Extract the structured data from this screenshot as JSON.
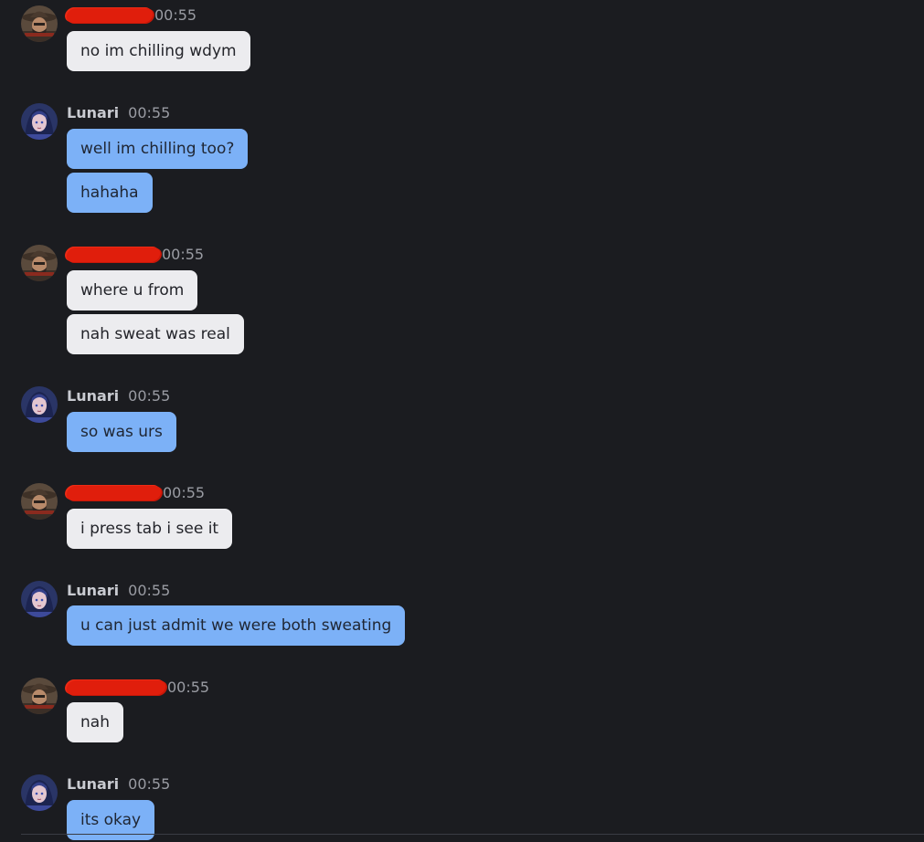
{
  "colors": {
    "background": "#1b1c20",
    "incoming_bubble": "#ececef",
    "outgoing_bubble": "#7cb1f7",
    "redaction": "#e01e0c",
    "timestamp": "#9a9ca3"
  },
  "messages": [
    {
      "author": "",
      "author_redacted": true,
      "time": "00:55",
      "avatar_icon": "cowboy-avatar-icon",
      "lines": [
        "no im chilling wdym"
      ],
      "side": "in"
    },
    {
      "author": "Lunari",
      "author_redacted": false,
      "time": "00:55",
      "avatar_icon": "blue-haired-girl-avatar-icon",
      "lines": [
        "well im chilling too?",
        "hahaha"
      ],
      "side": "out"
    },
    {
      "author": "",
      "author_redacted": true,
      "time": "00:55",
      "avatar_icon": "cowboy-avatar-icon",
      "lines": [
        "where u from",
        "nah sweat was real"
      ],
      "side": "in"
    },
    {
      "author": "Lunari",
      "author_redacted": false,
      "time": "00:55",
      "avatar_icon": "blue-haired-girl-avatar-icon",
      "lines": [
        "so was urs"
      ],
      "side": "out"
    },
    {
      "author": "",
      "author_redacted": true,
      "time": "00:55",
      "avatar_icon": "cowboy-avatar-icon",
      "lines": [
        "i press tab i see it"
      ],
      "side": "in"
    },
    {
      "author": "Lunari",
      "author_redacted": false,
      "time": "00:55",
      "avatar_icon": "blue-haired-girl-avatar-icon",
      "lines": [
        "u can just admit we were both sweating"
      ],
      "side": "out"
    },
    {
      "author": "",
      "author_redacted": true,
      "time": "00:55",
      "avatar_icon": "cowboy-avatar-icon",
      "lines": [
        "nah"
      ],
      "side": "in"
    },
    {
      "author": "Lunari",
      "author_redacted": false,
      "time": "00:55",
      "avatar_icon": "blue-haired-girl-avatar-icon",
      "lines": [
        "its okay"
      ],
      "side": "out"
    }
  ]
}
